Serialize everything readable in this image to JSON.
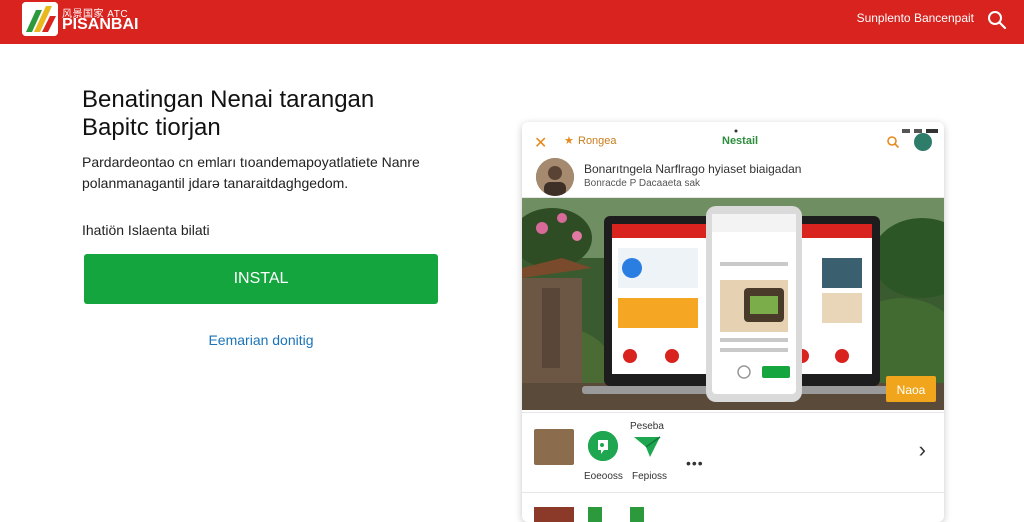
{
  "header": {
    "logo_small": "风景国家 ATC",
    "logo_text": "PISANBAI",
    "top_link": "Sunplento Bancenpait",
    "search_icon": "search-icon",
    "bg_color": "#d8231f"
  },
  "hero": {
    "title": "Benatingan Nenai tarangan Bapitc tiorjan",
    "description": "Pardardeontao cn emları tıoandemapoyatlatiete Nanre polanmanagantil jdarə tanaraitdaghgedom.",
    "small_label": "Ihatiön Islaenta bilati",
    "install_label": "INSTAL",
    "install_color": "#14a53e",
    "secondary_link": "Eemarian donitig"
  },
  "card": {
    "toolbar": {
      "back_icon": "chevron-left-icon",
      "star_label": "Rongea",
      "title": "Nestail",
      "search_icon": "search-icon"
    },
    "profile": {
      "name": "Bonarıtngela Narflrago hyiaset biaigadan",
      "sub": "Bonracde P Dacaaeta sak"
    },
    "image": {
      "nearby_label": "Naoa"
    },
    "row": {
      "heading": "Peseba",
      "label1": "Eoeooss",
      "label2": "Fepioss",
      "more": "•••",
      "chevron": "›"
    }
  }
}
